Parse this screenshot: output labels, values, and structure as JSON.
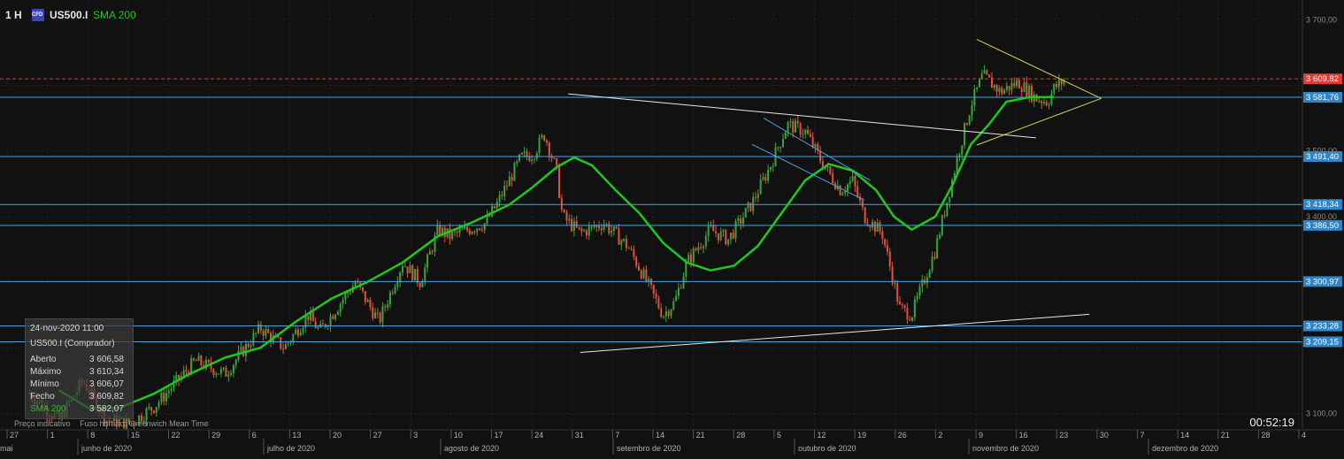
{
  "header": {
    "timeframe": "1 H",
    "symbol": "US500.I",
    "indicator": "SMA 200",
    "cfd_badge": "CFD"
  },
  "infobox": {
    "date": "24-nov-2020 11:00",
    "instrument": "US500.I (Comprador)",
    "rows": [
      {
        "label": "Aberto",
        "value": "3 606,58"
      },
      {
        "label": "Máximo",
        "value": "3 610,34"
      },
      {
        "label": "Mínimo",
        "value": "3 606,07"
      },
      {
        "label": "Fecho",
        "value": "3 609,82"
      },
      {
        "label": "SMA 200",
        "value": "3 582,07"
      }
    ]
  },
  "footer": {
    "price_label": "Preço indicativo",
    "timezone": "Fuso horário: Greenwich Mean Time",
    "clock": "00:52:19"
  },
  "colors": {
    "background": "#111111",
    "grid": "#2a2a2a",
    "candle_up": "#3aa43a",
    "candle_down": "#e0523c",
    "sma": "#1ec81e",
    "hline": "#4aa3df",
    "current_price": "#e03a3a",
    "trendline": "#e8e8e8",
    "triangle": "#e3d24a"
  },
  "chart_data": {
    "type": "candlestick",
    "interval": "1 H",
    "ylim": [
      3075,
      3730
    ],
    "y_ticks": [
      "3 100,00",
      "3 700,00",
      "3 500,00",
      "3 400,00"
    ],
    "x_day_labels": [
      "27",
      "1",
      "8",
      "15",
      "22",
      "29",
      "6",
      "13",
      "20",
      "27",
      "3",
      "10",
      "17",
      "24",
      "31",
      "7",
      "14",
      "21",
      "28",
      "5",
      "12",
      "19",
      "26",
      "2",
      "9",
      "16",
      "23",
      "30",
      "7",
      "14",
      "21",
      "28",
      "4"
    ],
    "x_month_labels": [
      "mai",
      "junho de 2020",
      "julho de 2020",
      "agosto de 2020",
      "setembro de 2020",
      "outubro de 2020",
      "novembro de 2020",
      "dezembro de 2020"
    ],
    "price_path": [
      [
        5,
        3130
      ],
      [
        10,
        3090
      ],
      [
        14,
        3150
      ],
      [
        18,
        3090
      ],
      [
        22,
        3085
      ],
      [
        26,
        3110
      ],
      [
        33,
        3180
      ],
      [
        38,
        3160
      ],
      [
        44,
        3230
      ],
      [
        48,
        3200
      ],
      [
        52,
        3250
      ],
      [
        54,
        3225
      ],
      [
        60,
        3300
      ],
      [
        64,
        3240
      ],
      [
        68,
        3330
      ],
      [
        71,
        3300
      ],
      [
        74,
        3380
      ],
      [
        76,
        3370
      ],
      [
        82,
        3390
      ],
      [
        84,
        3420
      ],
      [
        88,
        3490
      ],
      [
        90,
        3495
      ],
      [
        92,
        3525
      ],
      [
        94,
        3470
      ],
      [
        95,
        3400
      ],
      [
        98,
        3375
      ],
      [
        102,
        3390
      ],
      [
        106,
        3355
      ],
      [
        109,
        3305
      ],
      [
        112,
        3250
      ],
      [
        114,
        3270
      ],
      [
        116,
        3330
      ],
      [
        120,
        3380
      ],
      [
        123,
        3365
      ],
      [
        127,
        3420
      ],
      [
        130,
        3475
      ],
      [
        133,
        3540
      ],
      [
        136,
        3530
      ],
      [
        139,
        3480
      ],
      [
        142,
        3440
      ],
      [
        144,
        3455
      ],
      [
        146,
        3400
      ],
      [
        149,
        3375
      ],
      [
        152,
        3260
      ],
      [
        154,
        3250
      ],
      [
        156,
        3300
      ],
      [
        158,
        3350
      ],
      [
        160,
        3425
      ],
      [
        162,
        3500
      ],
      [
        164,
        3570
      ],
      [
        166,
        3615
      ],
      [
        169,
        3590
      ],
      [
        172,
        3605
      ],
      [
        175,
        3580
      ],
      [
        177,
        3575
      ],
      [
        178,
        3595
      ],
      [
        180,
        3609.82
      ]
    ],
    "sma_200": [
      [
        10,
        3135
      ],
      [
        15,
        3108
      ],
      [
        20,
        3108
      ],
      [
        26,
        3130
      ],
      [
        32,
        3160
      ],
      [
        38,
        3185
      ],
      [
        44,
        3200
      ],
      [
        50,
        3240
      ],
      [
        56,
        3275
      ],
      [
        62,
        3300
      ],
      [
        68,
        3330
      ],
      [
        74,
        3370
      ],
      [
        80,
        3392
      ],
      [
        86,
        3418
      ],
      [
        90,
        3445
      ],
      [
        94,
        3475
      ],
      [
        97,
        3490
      ],
      [
        100,
        3478
      ],
      [
        104,
        3440
      ],
      [
        108,
        3405
      ],
      [
        112,
        3360
      ],
      [
        116,
        3330
      ],
      [
        120,
        3318
      ],
      [
        124,
        3325
      ],
      [
        128,
        3355
      ],
      [
        132,
        3405
      ],
      [
        136,
        3455
      ],
      [
        140,
        3480
      ],
      [
        144,
        3470
      ],
      [
        148,
        3440
      ],
      [
        151,
        3400
      ],
      [
        154,
        3380
      ],
      [
        158,
        3400
      ],
      [
        161,
        3450
      ],
      [
        164,
        3510
      ],
      [
        167,
        3540
      ],
      [
        170,
        3575
      ],
      [
        174,
        3582
      ],
      [
        178,
        3582.07
      ]
    ],
    "horizontal_levels": [
      {
        "value": 3609.82,
        "label": "3 609,82",
        "style": "current"
      },
      {
        "value": 3581.76,
        "label": "3 581,76",
        "style": "level"
      },
      {
        "value": 3491.4,
        "label": "3 491,40",
        "style": "level"
      },
      {
        "value": 3418.34,
        "label": "3 418,34",
        "style": "level"
      },
      {
        "value": 3386.5,
        "label": "3 386,50",
        "style": "level"
      },
      {
        "value": 3300.97,
        "label": "3 300,97",
        "style": "level"
      },
      {
        "value": 3233.28,
        "label": "3 233,28",
        "style": "level"
      },
      {
        "value": 3209.15,
        "label": "3 209,15",
        "style": "level"
      }
    ],
    "trendlines": [
      {
        "from": [
          96,
          3587
        ],
        "to": [
          175,
          3520
        ],
        "style": "white"
      },
      {
        "from": [
          98,
          3193
        ],
        "to": [
          184,
          3251
        ],
        "style": "white"
      },
      {
        "from": [
          129,
          3550
        ],
        "to": [
          147,
          3455
        ],
        "style": "blue"
      },
      {
        "from": [
          127,
          3510
        ],
        "to": [
          146,
          3425
        ],
        "style": "blue"
      },
      {
        "from": [
          165,
          3670
        ],
        "to": [
          186,
          3580
        ],
        "style": "yellow"
      },
      {
        "from": [
          165,
          3509
        ],
        "to": [
          186,
          3580
        ],
        "style": "yellow"
      }
    ],
    "x_range": [
      0,
      220
    ],
    "legend": "top-left"
  }
}
